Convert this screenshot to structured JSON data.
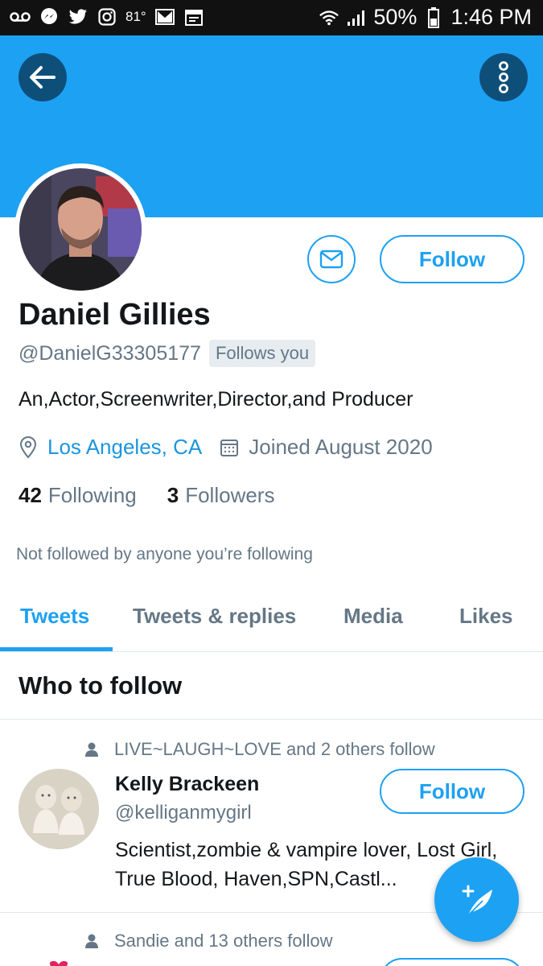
{
  "status_bar": {
    "temperature": "81°",
    "battery": "50%",
    "time": "1:46 PM",
    "icons": [
      "voicemail-icon",
      "messenger-icon",
      "twitter-icon",
      "instagram-icon",
      "gmail-icon",
      "calendar-icon",
      "wifi-icon",
      "signal-icon",
      "battery-icon"
    ]
  },
  "header": {
    "back_icon": "arrow-left-icon",
    "more_icon": "more-vertical-icon",
    "banner_color": "#1da1f2"
  },
  "profile": {
    "name": "Daniel Gillies",
    "handle": "@DanielG33305177",
    "follows_you": "Follows you",
    "bio": "An,Actor,Screenwriter,Director,and Producer",
    "location": "Los Angeles, CA",
    "joined": "Joined August 2020",
    "following_count": "42",
    "following_label": "Following",
    "followers_count": "3",
    "followers_label": "Followers",
    "not_followed": "Not followed by anyone you’re following",
    "follow_label": "Follow"
  },
  "tabs": [
    {
      "label": "Tweets",
      "active": true
    },
    {
      "label": "Tweets & replies",
      "active": false
    },
    {
      "label": "Media",
      "active": false
    },
    {
      "label": "Likes",
      "active": false
    }
  ],
  "who_to_follow": {
    "title": "Who to follow",
    "suggestions": [
      {
        "context": "LIVE~LAUGH~LOVE and 2 others follow",
        "name": "Kelly Brackeen",
        "handle": "@kelliganmygirl",
        "bio": "Scientist,zombie & vampire lover, Lost Girl, True Blood, Haven,SPN,Castl...",
        "follow_label": "Follow"
      },
      {
        "context": "Sandie and 13 others follow"
      }
    ]
  },
  "colors": {
    "accent": "#1da1f2",
    "dark_button": "#0e4f7a",
    "muted_text": "#657786"
  }
}
